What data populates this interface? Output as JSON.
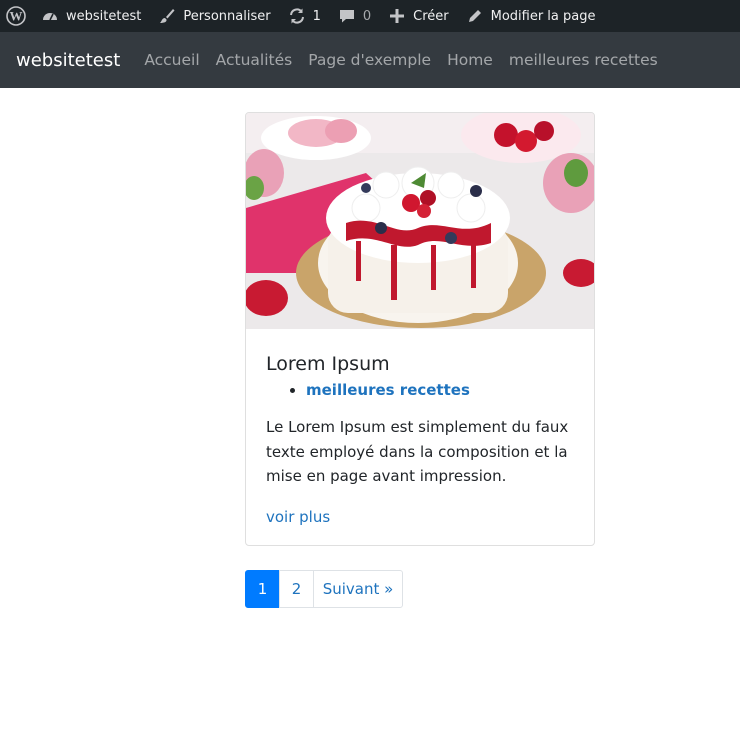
{
  "admin_bar": {
    "site_name": "websitetest",
    "customize": "Personnaliser",
    "updates_count": "1",
    "comments_count": "0",
    "create": "Créer",
    "edit_page": "Modifier la page"
  },
  "navbar": {
    "brand": "websitetest",
    "links": [
      "Accueil",
      "Actualités",
      "Page d'exemple",
      "Home",
      "meilleures recettes"
    ]
  },
  "post": {
    "image_alt": "Pavlova aux fraises",
    "title": "Lorem Ipsum",
    "categories": [
      "meilleures recettes"
    ],
    "excerpt": "Le Lorem Ipsum est simplement du faux texte employé dans la composition et la mise en page avant impression.",
    "read_more": "voir plus"
  },
  "pagination": {
    "pages": [
      "1",
      "2"
    ],
    "current": "1",
    "next": "Suivant »"
  },
  "colors": {
    "admin_bar_bg": "#1d2327",
    "navbar_bg": "#343a40",
    "link": "#1e73be",
    "active_page": "#007bff"
  }
}
